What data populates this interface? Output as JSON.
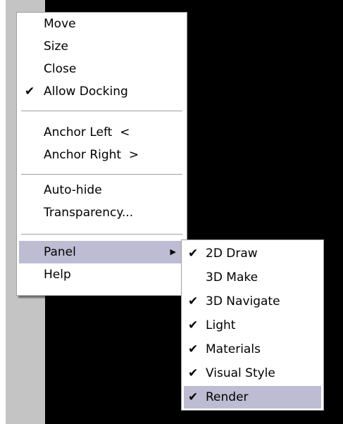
{
  "colors": {
    "menu_background": "#ffffff",
    "highlight": "#bdbcd3",
    "drawing_area": "#000000",
    "palette_strip": "#c4c4c4"
  },
  "context_menu": {
    "items": [
      {
        "label": "Move",
        "checked": false
      },
      {
        "label": "Size",
        "checked": false
      },
      {
        "label": "Close",
        "checked": false
      },
      {
        "label": "Allow Docking",
        "checked": true
      },
      {
        "label": "Anchor Left  <",
        "checked": false
      },
      {
        "label": "Anchor Right  >",
        "checked": false
      },
      {
        "label": "Auto-hide",
        "checked": false
      },
      {
        "label": "Transparency...",
        "checked": false
      },
      {
        "label": "Panel",
        "checked": false,
        "highlighted": true,
        "has_submenu": true
      },
      {
        "label": "Help",
        "checked": false
      }
    ]
  },
  "panel_submenu": {
    "items": [
      {
        "label": "2D Draw",
        "checked": true
      },
      {
        "label": "3D Make",
        "checked": false
      },
      {
        "label": "3D Navigate",
        "checked": true
      },
      {
        "label": "Light",
        "checked": true
      },
      {
        "label": "Materials",
        "checked": true
      },
      {
        "label": "Visual Style",
        "checked": true
      },
      {
        "label": "Render",
        "checked": true,
        "highlighted": true
      }
    ]
  },
  "glyphs": {
    "check": "✔",
    "submenu_arrow": "▶"
  }
}
